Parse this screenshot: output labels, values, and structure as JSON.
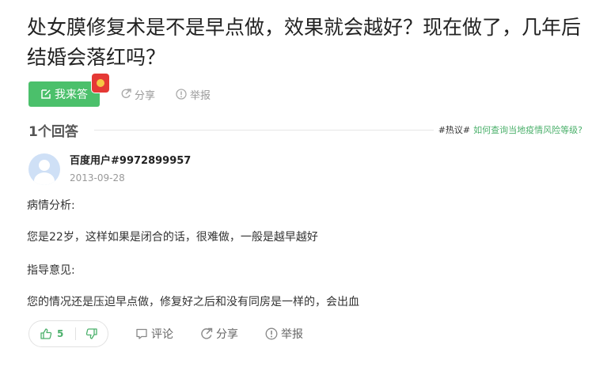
{
  "question": {
    "title": "处女膜修复术是不是早点做，效果就会越好？现在做了，几年后结婚会落红吗？"
  },
  "actions": {
    "answer_label": "我来答",
    "share_label": "分享",
    "report_label": "举报"
  },
  "answers_header": {
    "count_label": "1个回答",
    "hot_tag": "#热议#",
    "hot_link": "如何查询当地疫情风险等级?"
  },
  "answer": {
    "user_name": "百度用户#9972899957",
    "date": "2013-09-28",
    "paragraphs": [
      "病情分析:",
      "您是22岁，这样如果是闭合的话，很难做，一般是越早越好",
      "指导意见:",
      "您的情况还是压迫早点做，修复好之后和没有同房是一样的，会出血"
    ],
    "likes": "5",
    "comment_label": "评论",
    "share_label": "分享",
    "report_label": "举报"
  },
  "colors": {
    "accent_green": "#4bc06b",
    "link_green": "#4bb06b",
    "red_packet": "#e53935"
  }
}
